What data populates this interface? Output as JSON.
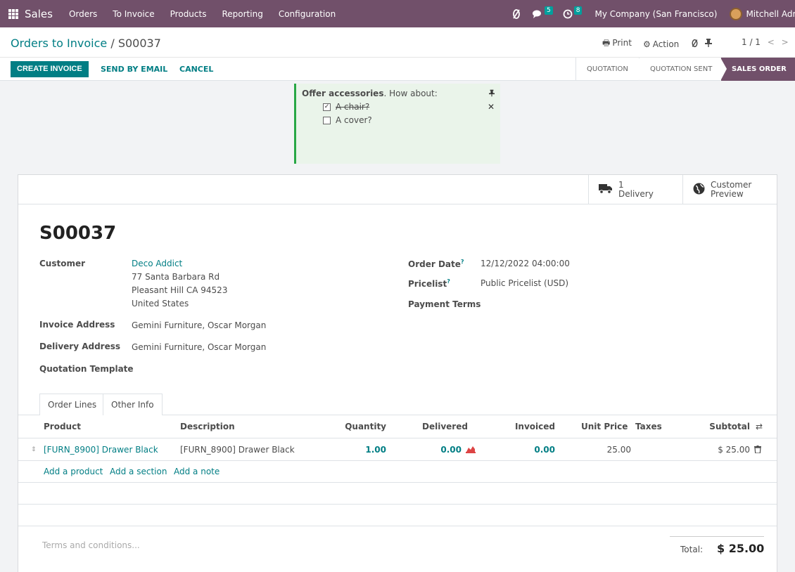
{
  "navbar": {
    "app_name": "Sales",
    "menus": [
      "Orders",
      "To Invoice",
      "Products",
      "Reporting",
      "Configuration"
    ],
    "messages_count": "5",
    "activities_count": "8",
    "company": "My Company (San Francisco)",
    "user": "Mitchell Admin"
  },
  "breadcrumb": {
    "parent": "Orders to Invoice",
    "separator": "/",
    "current": "S00037"
  },
  "top_actions": {
    "print": "Print",
    "action": "Action",
    "pager": "1 / 1"
  },
  "buttons": {
    "create_invoice": "CREATE INVOICE",
    "send_email": "SEND BY EMAIL",
    "cancel": "CANCEL"
  },
  "statusbar": [
    "QUOTATION",
    "QUOTATION SENT",
    "SALES ORDER"
  ],
  "suggestion": {
    "title_bold": "Offer accessories",
    "title_rest": ". How about:",
    "items": [
      {
        "label": "A chair?",
        "checked": true
      },
      {
        "label": "A cover?",
        "checked": false
      }
    ]
  },
  "smart_buttons": {
    "delivery_count": "1",
    "delivery_label": "Delivery",
    "preview_line1": "Customer",
    "preview_line2": "Preview"
  },
  "order": {
    "name": "S00037",
    "customer_label": "Customer",
    "customer_name": "Deco Addict",
    "customer_addr1": "77 Santa Barbara Rd",
    "customer_addr2": "Pleasant Hill CA 94523",
    "customer_addr3": "United States",
    "invoice_address_label": "Invoice Address",
    "invoice_address": "Gemini Furniture, Oscar Morgan",
    "delivery_address_label": "Delivery Address",
    "delivery_address": "Gemini Furniture, Oscar Morgan",
    "quotation_template_label": "Quotation Template",
    "order_date_label": "Order Date",
    "order_date": "12/12/2022 04:00:00",
    "pricelist_label": "Pricelist",
    "pricelist": "Public Pricelist (USD)",
    "payment_terms_label": "Payment Terms",
    "help_mark": "?"
  },
  "tabs": [
    "Order Lines",
    "Other Info"
  ],
  "table": {
    "headers": {
      "product": "Product",
      "description": "Description",
      "quantity": "Quantity",
      "delivered": "Delivered",
      "invoiced": "Invoiced",
      "unit_price": "Unit Price",
      "taxes": "Taxes",
      "subtotal": "Subtotal"
    },
    "rows": [
      {
        "product": "[FURN_8900] Drawer Black",
        "description": "[FURN_8900] Drawer Black",
        "quantity": "1.00",
        "delivered": "0.00",
        "invoiced": "0.00",
        "unit_price": "25.00",
        "taxes": "",
        "subtotal": "$ 25.00"
      }
    ],
    "add_product": "Add a product",
    "add_section": "Add a section",
    "add_note": "Add a note"
  },
  "footer": {
    "terms_placeholder": "Terms and conditions...",
    "total_label": "Total:",
    "total_value": "$ 25.00"
  },
  "colors": {
    "brand": "#71506a",
    "accent": "#017e84"
  }
}
